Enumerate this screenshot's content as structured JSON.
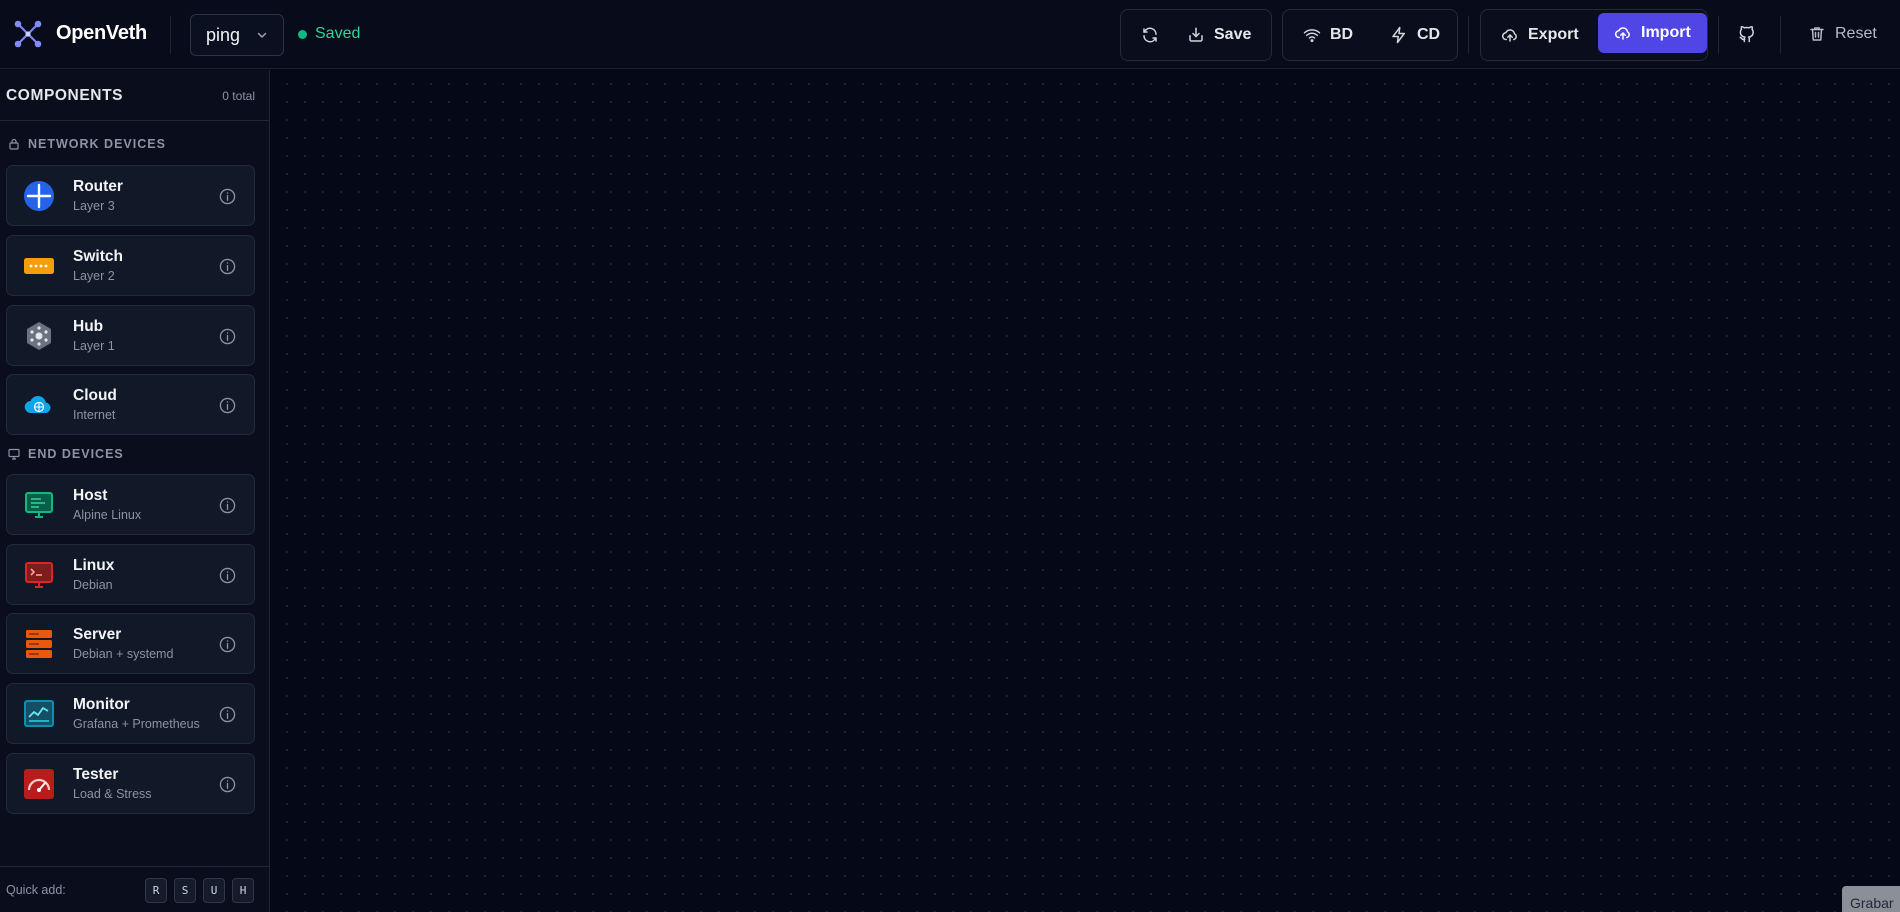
{
  "app": {
    "title": "OpenVeth"
  },
  "project": {
    "name": "ping",
    "status": "Saved"
  },
  "toolbar": {
    "save_label": "Save",
    "bd_label": "BD",
    "cd_label": "CD",
    "export_label": "Export",
    "import_label": "Import",
    "reset_label": "Reset"
  },
  "sidebar": {
    "title": "COMPONENTS",
    "count": "0 total",
    "sections": [
      {
        "label": "NETWORK DEVICES",
        "icon": "lock-icon",
        "items": [
          {
            "name": "Router",
            "subtitle": "Layer 3",
            "icon": "router-icon"
          },
          {
            "name": "Switch",
            "subtitle": "Layer 2",
            "icon": "switch-icon"
          },
          {
            "name": "Hub",
            "subtitle": "Layer 1",
            "icon": "hub-icon"
          },
          {
            "name": "Cloud",
            "subtitle": "Internet",
            "icon": "cloud-icon"
          }
        ]
      },
      {
        "label": "END DEVICES",
        "icon": "monitor-icon",
        "items": [
          {
            "name": "Host",
            "subtitle": "Alpine Linux",
            "icon": "host-icon"
          },
          {
            "name": "Linux",
            "subtitle": "Debian",
            "icon": "linux-icon"
          },
          {
            "name": "Server",
            "subtitle": "Debian + systemd",
            "icon": "server-icon"
          },
          {
            "name": "Monitor",
            "subtitle": "Grafana + Prometheus",
            "icon": "monitor-chart-icon"
          },
          {
            "name": "Tester",
            "subtitle": "Load & Stress",
            "icon": "gauge-icon"
          }
        ]
      }
    ],
    "footer": {
      "quick_add_label": "Quick add:",
      "keys": [
        "R",
        "S",
        "U",
        "H"
      ]
    }
  },
  "canvas": {
    "corner_text": "Grabar"
  },
  "colors": {
    "accent": "#4f46e5",
    "saved": "#10b981",
    "router": "#2563eb",
    "switch": "#f59e0b",
    "cloud": "#0ea5e9",
    "host": "#10b981",
    "linux": "#dc2626",
    "server": "#ea580c",
    "monitor": "#0891b2",
    "tester": "#dc2626"
  }
}
